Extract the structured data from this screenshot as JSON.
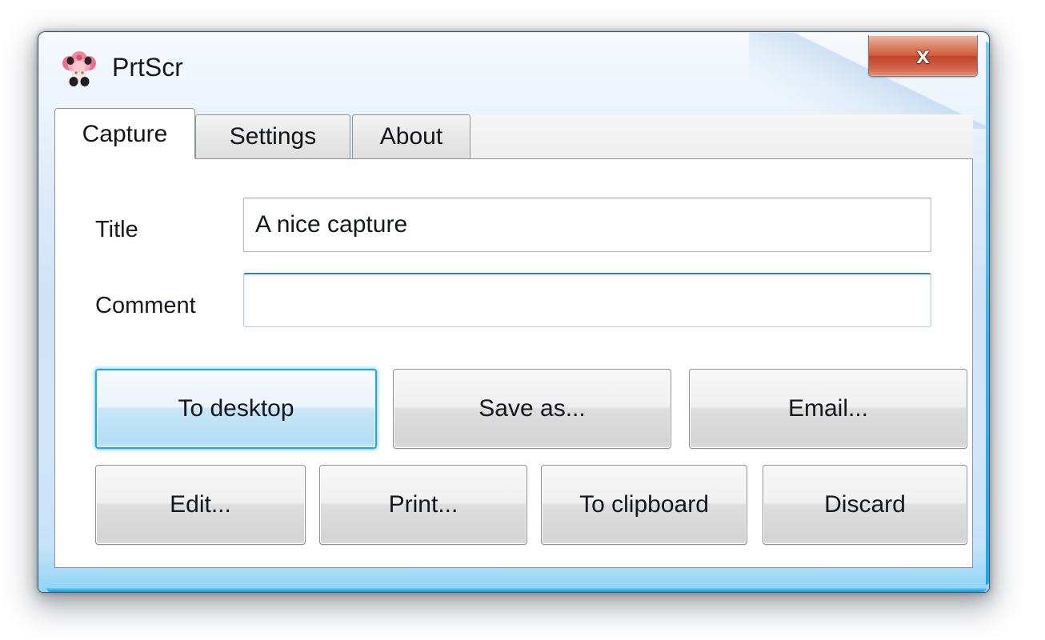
{
  "window": {
    "title": "PrtScr",
    "icon": "prtscr-app-icon",
    "close_label": "x",
    "accent_color": "#1ba9ec",
    "titlebar_color": "#cfe3f8",
    "close_button_color": "#c1432a"
  },
  "tabs": [
    {
      "id": "capture",
      "label": "Capture",
      "active": true
    },
    {
      "id": "settings",
      "label": "Settings",
      "active": false
    },
    {
      "id": "about",
      "label": "About",
      "active": false
    }
  ],
  "form": {
    "title": {
      "label": "Title",
      "value": "A nice capture",
      "placeholder": ""
    },
    "comment": {
      "label": "Comment",
      "value": "",
      "placeholder": ""
    }
  },
  "actions": {
    "row1": [
      {
        "id": "to-desktop",
        "label": "To desktop",
        "default": true
      },
      {
        "id": "save-as",
        "label": "Save as...",
        "default": false
      },
      {
        "id": "email",
        "label": "Email...",
        "default": false
      }
    ],
    "row2": [
      {
        "id": "edit",
        "label": "Edit...",
        "default": false
      },
      {
        "id": "print",
        "label": "Print...",
        "default": false
      },
      {
        "id": "to-clipboard",
        "label": "To clipboard",
        "default": false
      },
      {
        "id": "discard",
        "label": "Discard",
        "default": false
      }
    ]
  }
}
